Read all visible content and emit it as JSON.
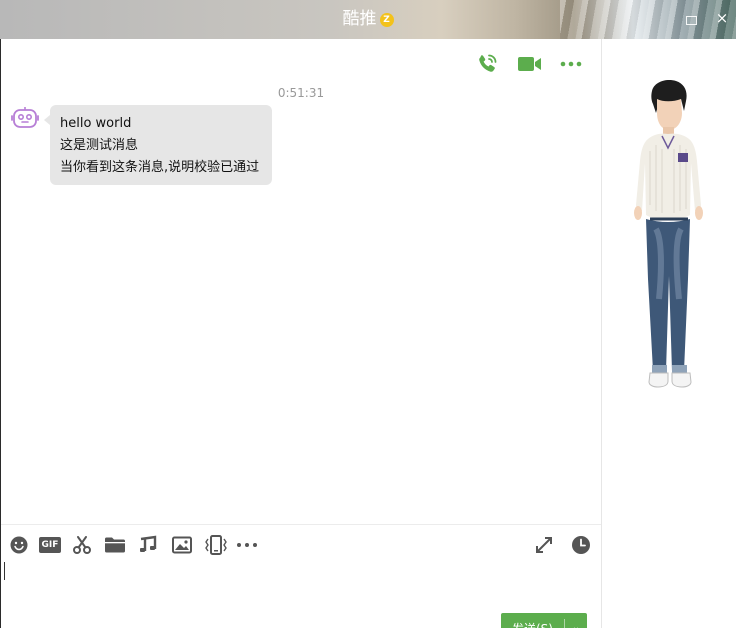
{
  "window": {
    "title": "酷推",
    "vip_badge": "Z",
    "close_glyph": "×"
  },
  "chat": {
    "timestamp": "0:51:31",
    "messages": [
      {
        "sender": "bot",
        "lines": [
          "hello world",
          "这是测试消息",
          "当你看到这条消息,说明校验已通过"
        ]
      }
    ]
  },
  "header_actions": [
    {
      "icon": "phone-call-icon"
    },
    {
      "icon": "video-call-icon"
    },
    {
      "icon": "more-icon"
    }
  ],
  "toolbar": {
    "items": [
      "emoji-icon",
      "gif-icon",
      "scissors-icon",
      "folder-icon",
      "music-note-icon",
      "image-icon",
      "shake-icon",
      "more-icon",
      "expand-icon",
      "history-clock-icon"
    ],
    "gif_label": "GIF"
  },
  "send_button": {
    "label": "发送(S)",
    "dropdown_glyph": "⌄"
  },
  "colors": {
    "accent_green": "#5cad4d",
    "bubble_bg": "#e6e6e6",
    "icon_gray": "#555555",
    "bot_avatar": "#b77fd6"
  }
}
